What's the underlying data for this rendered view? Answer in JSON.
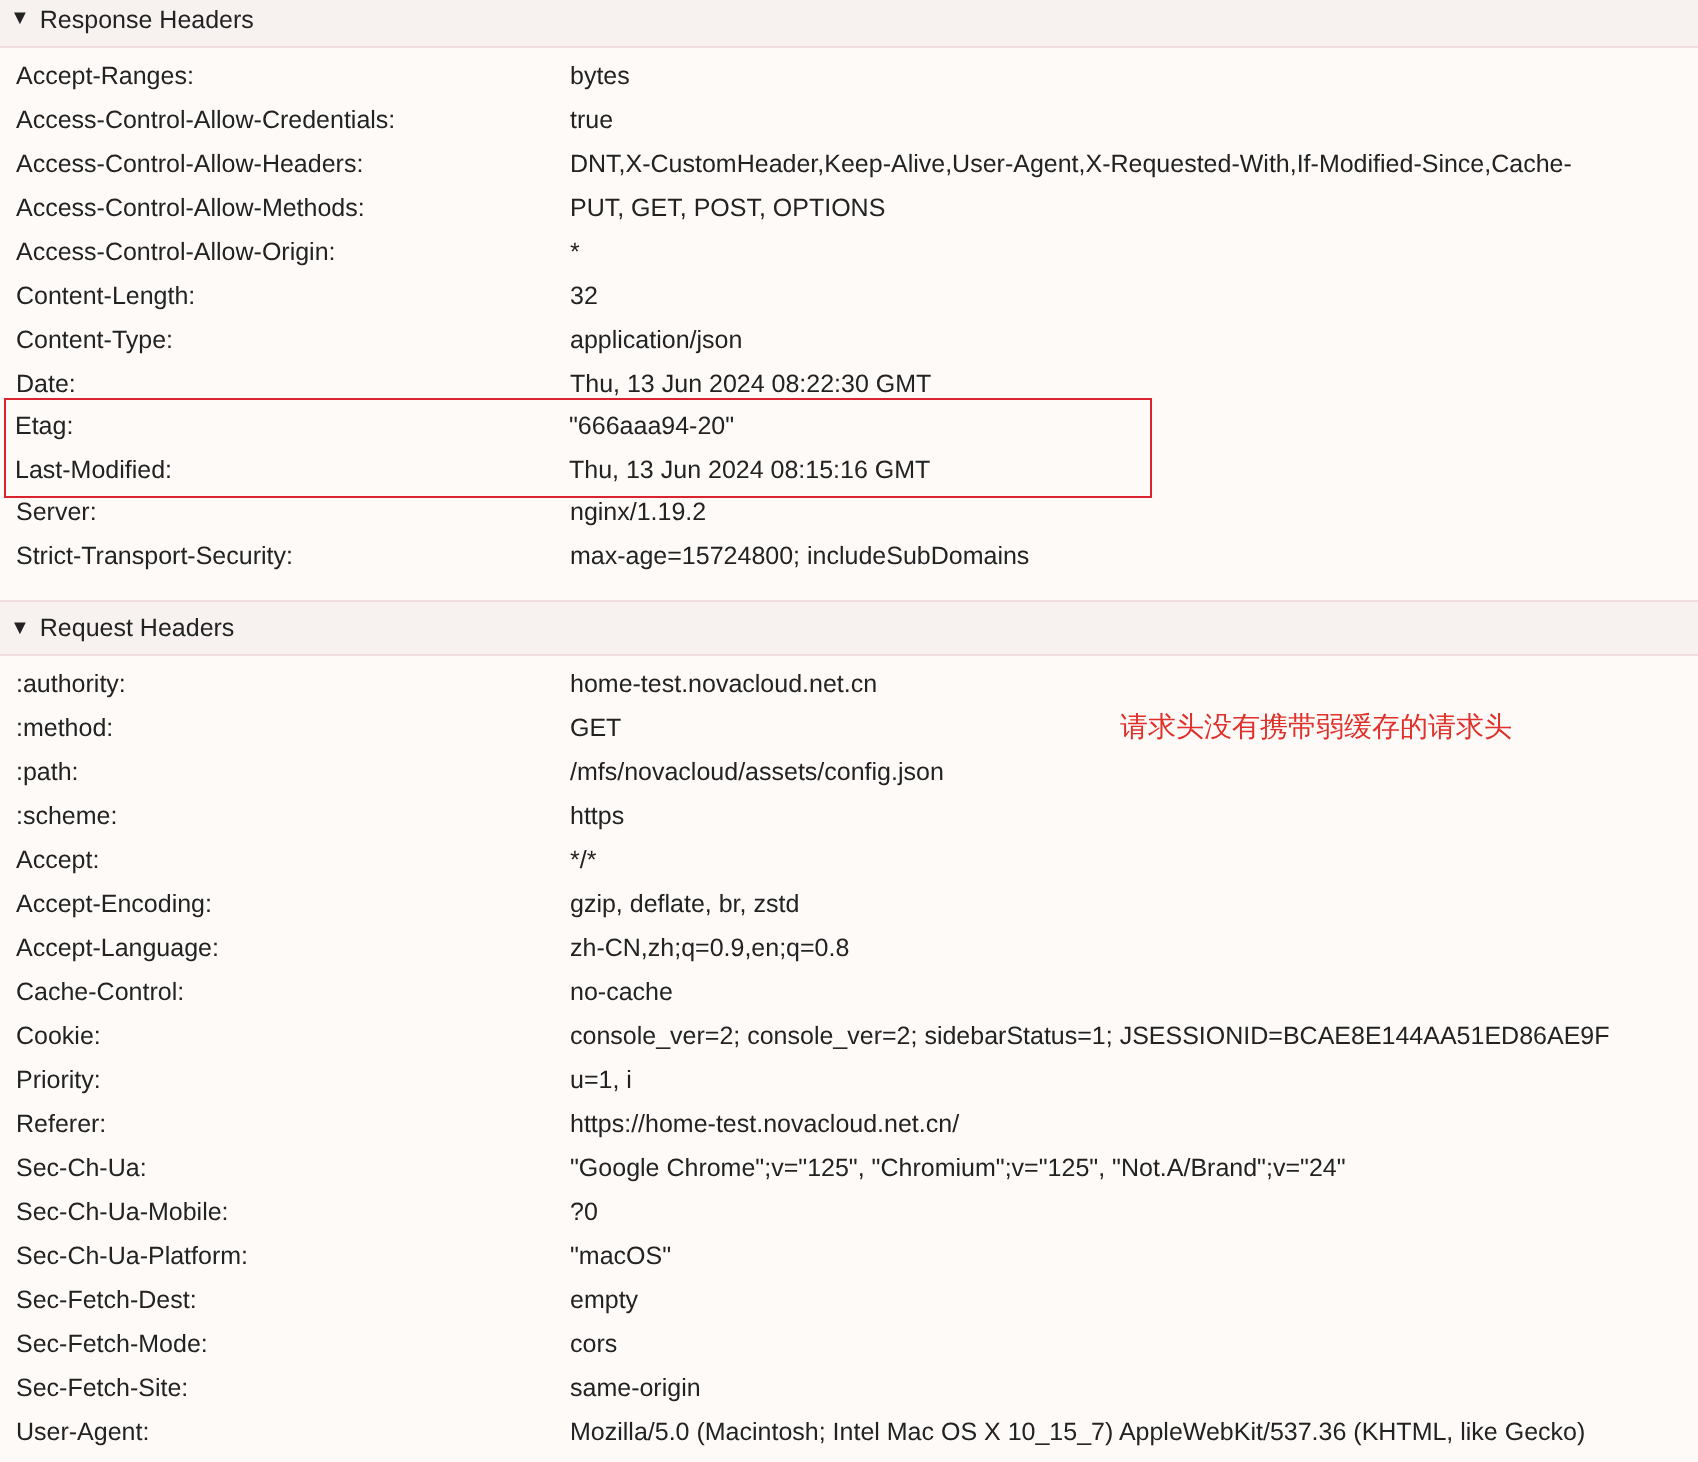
{
  "sections": [
    {
      "toggle": "▼",
      "title": "Response Headers",
      "expanded": true,
      "rows": [
        {
          "kind": "row",
          "name": "Accept-Ranges:",
          "value": "bytes"
        },
        {
          "kind": "row",
          "name": "Access-Control-Allow-Credentials:",
          "value": "true"
        },
        {
          "kind": "row",
          "name": "Access-Control-Allow-Headers:",
          "value": "DNT,X-CustomHeader,Keep-Alive,User-Agent,X-Requested-With,If-Modified-Since,Cache-"
        },
        {
          "kind": "row",
          "name": "Access-Control-Allow-Methods:",
          "value": "PUT, GET, POST, OPTIONS"
        },
        {
          "kind": "row",
          "name": "Access-Control-Allow-Origin:",
          "value": "*"
        },
        {
          "kind": "row",
          "name": "Content-Length:",
          "value": "32"
        },
        {
          "kind": "row",
          "name": "Content-Type:",
          "value": "application/json"
        },
        {
          "kind": "row",
          "name": "Date:",
          "value": "Thu, 13 Jun 2024 08:22:30 GMT"
        },
        {
          "kind": "boxed",
          "children": [
            {
              "name": "Etag:",
              "value": "\"666aaa94-20\""
            },
            {
              "name": "Last-Modified:",
              "value": "Thu, 13 Jun 2024 08:15:16 GMT"
            }
          ]
        },
        {
          "kind": "row",
          "name": "Server:",
          "value": "nginx/1.19.2"
        },
        {
          "kind": "row",
          "name": "Strict-Transport-Security:",
          "value": "max-age=15724800; includeSubDomains"
        }
      ]
    },
    {
      "toggle": "▼",
      "title": "Request Headers",
      "expanded": true,
      "annotation": "请求头没有携带弱缓存的请求头",
      "rows": [
        {
          "kind": "row",
          "name": ":authority:",
          "value": "home-test.novacloud.net.cn"
        },
        {
          "kind": "row",
          "name": ":method:",
          "value": "GET"
        },
        {
          "kind": "row",
          "name": ":path:",
          "value": "/mfs/novacloud/assets/config.json"
        },
        {
          "kind": "row",
          "name": ":scheme:",
          "value": "https"
        },
        {
          "kind": "row",
          "name": "Accept:",
          "value": "*/*"
        },
        {
          "kind": "row",
          "name": "Accept-Encoding:",
          "value": "gzip, deflate, br, zstd"
        },
        {
          "kind": "row",
          "name": "Accept-Language:",
          "value": "zh-CN,zh;q=0.9,en;q=0.8"
        },
        {
          "kind": "row",
          "name": "Cache-Control:",
          "value": "no-cache"
        },
        {
          "kind": "row",
          "name": "Cookie:",
          "value": "console_ver=2; console_ver=2; sidebarStatus=1; JSESSIONID=BCAE8E144AA51ED86AE9F"
        },
        {
          "kind": "row",
          "name": "Priority:",
          "value": "u=1, i"
        },
        {
          "kind": "row",
          "name": "Referer:",
          "value": "https://home-test.novacloud.net.cn/"
        },
        {
          "kind": "row",
          "name": "Sec-Ch-Ua:",
          "value": "\"Google Chrome\";v=\"125\", \"Chromium\";v=\"125\", \"Not.A/Brand\";v=\"24\""
        },
        {
          "kind": "row",
          "name": "Sec-Ch-Ua-Mobile:",
          "value": "?0"
        },
        {
          "kind": "row",
          "name": "Sec-Ch-Ua-Platform:",
          "value": "\"macOS\""
        },
        {
          "kind": "row",
          "name": "Sec-Fetch-Dest:",
          "value": "empty"
        },
        {
          "kind": "row",
          "name": "Sec-Fetch-Mode:",
          "value": "cors"
        },
        {
          "kind": "row",
          "name": "Sec-Fetch-Site:",
          "value": "same-origin"
        },
        {
          "kind": "row",
          "name": "User-Agent:",
          "value": "Mozilla/5.0 (Macintosh; Intel Mac OS X 10_15_7) AppleWebKit/537.36 (KHTML, like Gecko)"
        }
      ]
    }
  ]
}
